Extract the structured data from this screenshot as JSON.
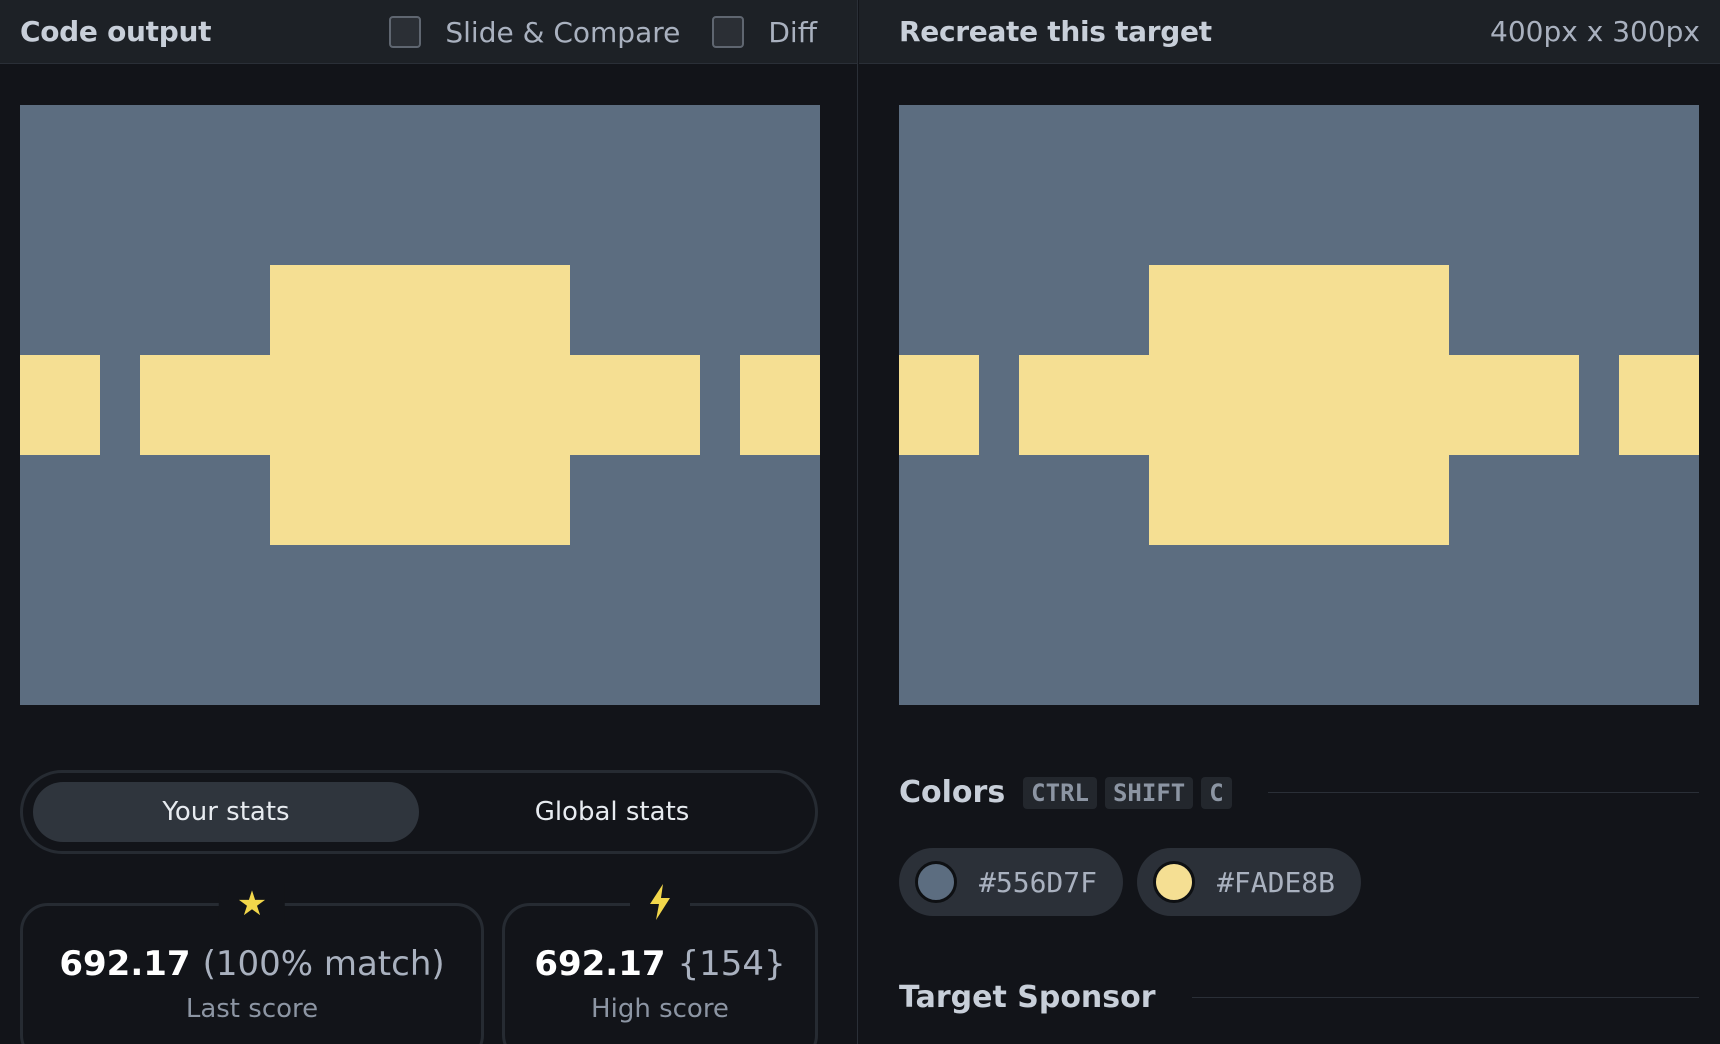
{
  "left_panel": {
    "title": "Code output",
    "toggles": [
      {
        "label": "Slide & Compare",
        "checked": false
      },
      {
        "label": "Diff",
        "checked": false
      }
    ],
    "stats_tabs": {
      "active": "Your stats",
      "inactive": "Global stats"
    },
    "last_score": {
      "icon": "star-icon",
      "value": "692.17",
      "extra": "(100% match)",
      "caption": "Last score"
    },
    "high_score": {
      "icon": "lightning-icon",
      "value": "692.17",
      "extra": "{154}",
      "caption": "High score"
    }
  },
  "right_panel": {
    "title": "Recreate this target",
    "dimensions": "400px x 300px",
    "colors_title": "Colors",
    "shortcut_keys": [
      "CTRL",
      "SHIFT",
      "C"
    ],
    "colors": [
      {
        "hex": "#556D7F",
        "swatch_color": "#5c6d80"
      },
      {
        "hex": "#FADE8B",
        "swatch_color": "#f5df93"
      }
    ],
    "sponsor_title": "Target Sponsor"
  },
  "canvas_colors": {
    "background": "#5c6d80",
    "shape": "#f5df93"
  }
}
